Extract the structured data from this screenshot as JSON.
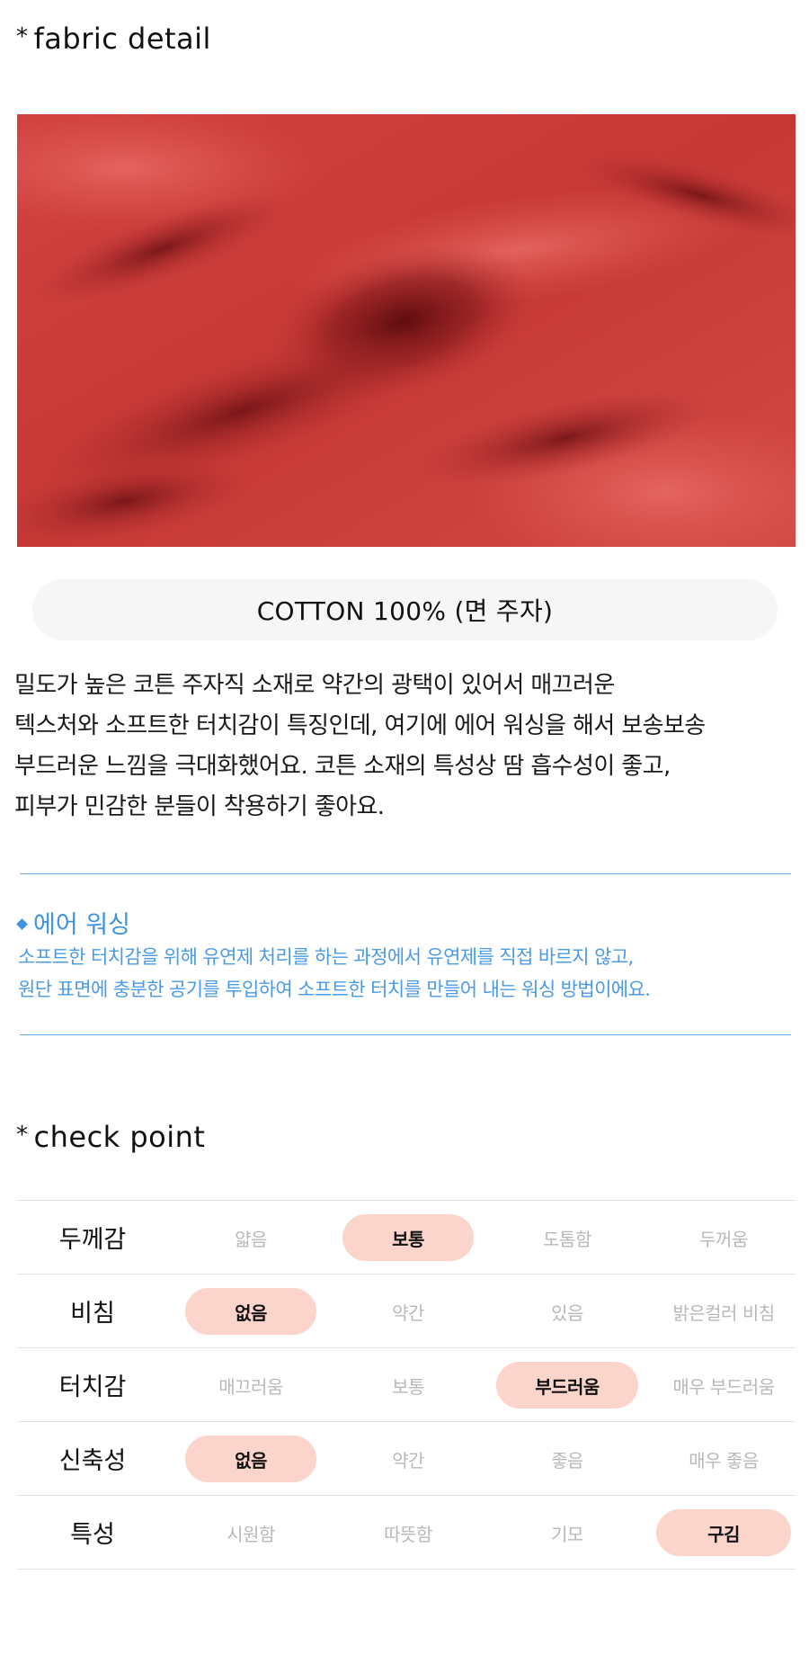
{
  "fabric_section": {
    "star": "*",
    "title": "fabric detail",
    "material_label": "COTTON 100% (면 주자)",
    "description_lines": [
      "밀도가 높은 코튼 주자직 소재로 약간의 광택이 있어서 매끄러운",
      "텍스처와 소프트한 터치감이 특징인데, 여기에 에어 워싱을 해서 보송보송",
      "부드러운 느낌을 극대화했어요. 코튼 소재의 특성상 땀 흡수성이 좋고,",
      "피부가 민감한 분들이 착용하기 좋아요."
    ],
    "photo_color": "#c73b3a"
  },
  "note": {
    "heading": "에어 워싱",
    "lines": [
      "소프트한 터치감을 위해 유연제 처리를 하는 과정에서 유연제를 직접 바르지 않고,",
      "원단 표면에 충분한 공기를 투입하여 소프트한 터치를 만들어 내는 워싱 방법이에요."
    ],
    "accent_color": "#3d93e0"
  },
  "check_section": {
    "star": "*",
    "title": "check point",
    "highlight_color": "#fbd5cb",
    "rows": [
      {
        "label": "두께감",
        "options": [
          "얇음",
          "보통",
          "도톰함",
          "두꺼움"
        ],
        "selected": 1
      },
      {
        "label": "비침",
        "options": [
          "없음",
          "약간",
          "있음",
          "밝은컬러 비침"
        ],
        "selected": 0
      },
      {
        "label": "터치감",
        "options": [
          "매끄러움",
          "보통",
          "부드러움",
          "매우 부드러움"
        ],
        "selected": 2
      },
      {
        "label": "신축성",
        "options": [
          "없음",
          "약간",
          "좋음",
          "매우 좋음"
        ],
        "selected": 0
      },
      {
        "label": "특성",
        "options": [
          "시원함",
          "따뜻함",
          "기모",
          "구김"
        ],
        "selected": 3
      }
    ]
  }
}
